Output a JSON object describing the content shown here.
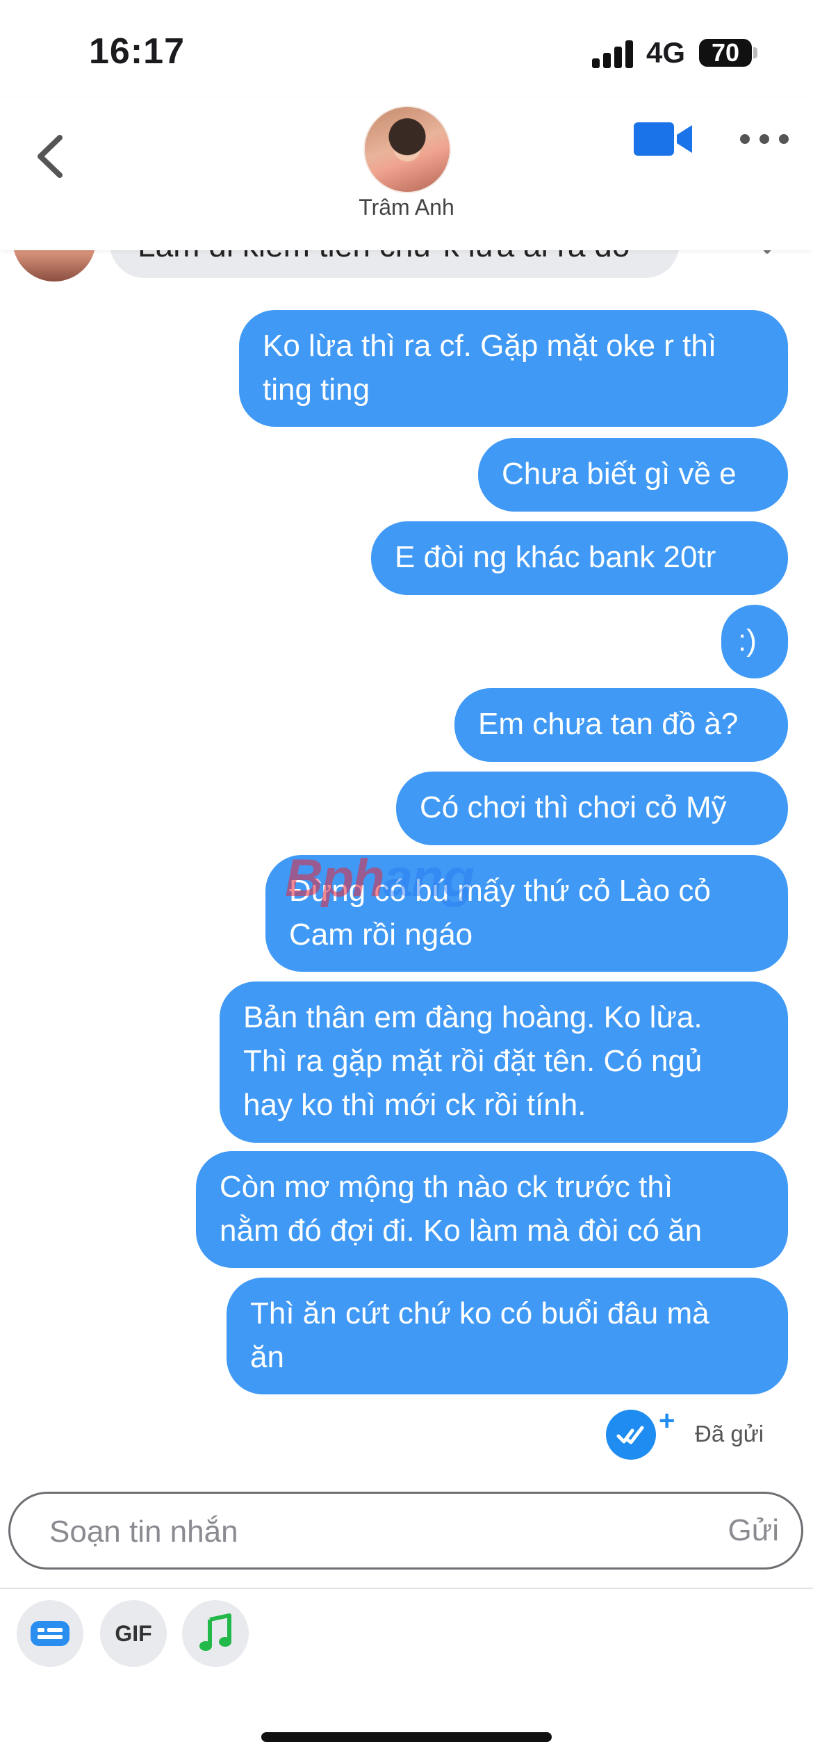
{
  "status_bar": {
    "time": "16:17",
    "network": "4G",
    "battery": "70"
  },
  "header": {
    "contact_name": "Trâm Anh"
  },
  "incoming": {
    "partial_text": "Làm đi kiếm tiền chứ k lừa ai rà đó"
  },
  "messages": [
    {
      "text": "Ko lừa thì ra cf. Gặp mặt oke r thì\nting ting"
    },
    {
      "text": "Chưa biết gì về e"
    },
    {
      "text": "E đòi ng khác bank 20tr"
    },
    {
      "text": ":)"
    },
    {
      "text": "Em chưa tan đồ à?"
    },
    {
      "text": "Có chơi thì chơi cỏ Mỹ"
    },
    {
      "text": "Đừng có bú mấy thứ cỏ Lào cỏ\nCam rồi ngáo"
    },
    {
      "text": "Bản thân em đàng hoàng. Ko lừa.\nThì ra gặp mặt rồi đặt tên. Có ngủ\nhay ko thì mới ck rồi tính."
    },
    {
      "text": "Còn mơ mộng th nào ck trước thì\nnằm đó đợi đi. Ko làm mà đòi có ăn"
    },
    {
      "text": "Thì ăn cứt chứ ko có buổi đâu mà\năn"
    }
  ],
  "sent_status": "Đã gửi",
  "composer": {
    "placeholder": "Soạn tin nhắn",
    "send_label": "Gửi"
  },
  "tools": {
    "gif_label": "GIF"
  },
  "watermark": {
    "part1": "Bph",
    "part2": "ang"
  },
  "colors": {
    "bubble": "#3f99f5",
    "accent": "#1e8cf0",
    "video_icon": "#1a73e8"
  },
  "icons": [
    "chevron-left-icon",
    "video-camera-icon",
    "more-horizontal-icon",
    "heart-outline-icon",
    "double-check-icon",
    "plus-icon",
    "sticker-icon",
    "gif-icon",
    "music-note-icon"
  ]
}
